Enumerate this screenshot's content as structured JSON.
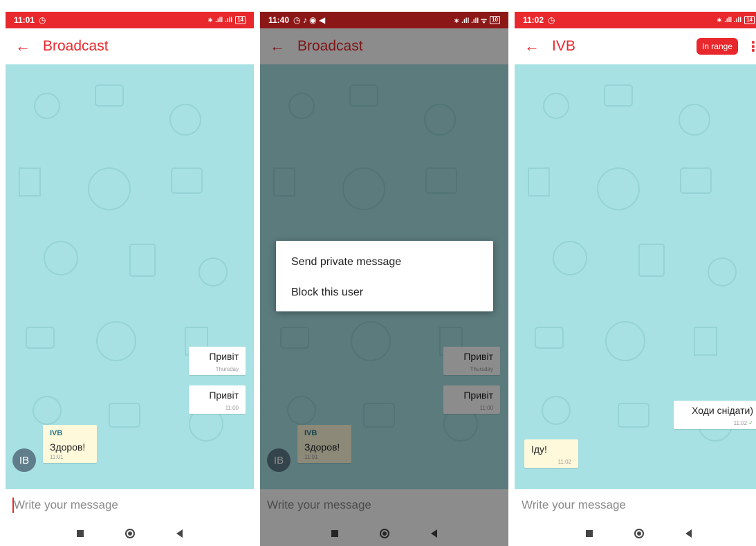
{
  "colors": {
    "accent": "#e8282c",
    "chat_bg": "#a7e1e3",
    "incoming_bubble": "#fff9dc",
    "avatar": "#607d8b"
  },
  "screen1": {
    "status": {
      "time": "11:01",
      "alarm": "alarm-icon",
      "signal": "∗ .ıll .ıll",
      "battery": "14"
    },
    "title": "Broadcast",
    "messages": [
      {
        "text": "Привіт",
        "time": "Thursday"
      },
      {
        "text": "Привіт",
        "time": "11:00"
      }
    ],
    "incoming": {
      "sender": "IVB",
      "text": "Здоров!",
      "time": "11:01",
      "avatar": "IB"
    },
    "input_placeholder": "Write your message"
  },
  "screen2": {
    "status": {
      "time": "11:40",
      "icons": "◷ ♪ ◉ ◀",
      "signal": "∗ .ıll .ıll ᯤ",
      "battery": "10"
    },
    "title": "Broadcast",
    "messages": [
      {
        "text": "Привіт",
        "time": "Thursday"
      },
      {
        "text": "Привіт",
        "time": "11:00"
      }
    ],
    "incoming": {
      "sender": "IVB",
      "text": "Здоров!",
      "time": "11:01",
      "avatar": "IB"
    },
    "dialog": {
      "option1": "Send private message",
      "option2": "Block this user"
    },
    "input_placeholder": "Write your message"
  },
  "screen3": {
    "status": {
      "time": "11:02",
      "alarm": "alarm-icon",
      "signal": "∗ .ıll .ıll",
      "battery": "14"
    },
    "title": "IVB",
    "badge": "In range",
    "outgoing": {
      "text": "Ходи снідати)",
      "time": "11:02"
    },
    "incoming": {
      "text": "Іду!",
      "time": "11:02"
    },
    "input_placeholder": "Write your message"
  }
}
